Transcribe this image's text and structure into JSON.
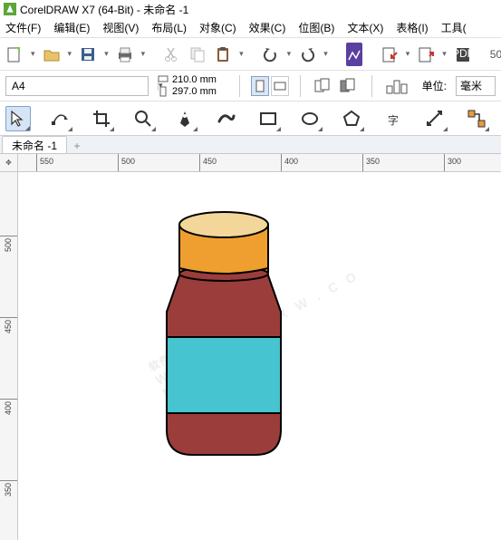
{
  "title": "CorelDRAW X7 (64-Bit) - 未命名 -1",
  "menu": {
    "file": "文件(F)",
    "edit": "编辑(E)",
    "view": "视图(V)",
    "layout": "布局(L)",
    "object": "对象(C)",
    "effects": "效果(C)",
    "bitmap": "位图(B)",
    "text": "文本(X)",
    "table": "表格(I)",
    "tools": "工具("
  },
  "page": {
    "size_name": "A4",
    "width": "210.0 mm",
    "height": "297.0 mm"
  },
  "units": {
    "label": "单位:",
    "value": "毫米"
  },
  "percent_field": "50",
  "doc_tab": "未命名 -1",
  "ruler_h": [
    "550",
    "500",
    "450",
    "400",
    "350",
    "300"
  ],
  "ruler_v": [
    "500",
    "450",
    "400",
    "350"
  ],
  "watermark": {
    "main": "软件自学网",
    "sub": "W W W . R J Z X W . C O M"
  }
}
